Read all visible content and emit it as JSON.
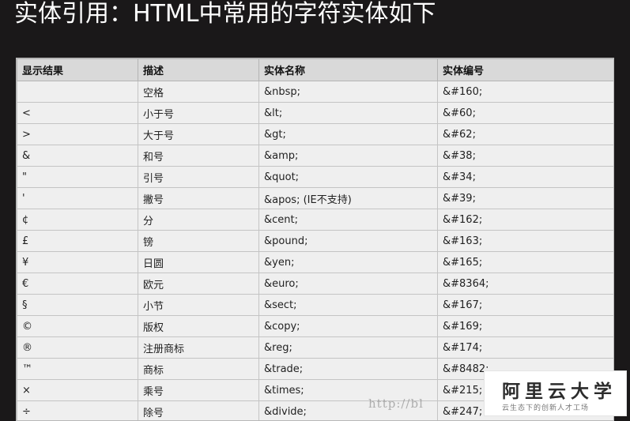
{
  "title": "实体引用：HTML中常用的字符实体如下",
  "table": {
    "headers": [
      "显示结果",
      "描述",
      "实体名称",
      "实体编号"
    ],
    "rows": [
      [
        "",
        "空格",
        "&nbsp;",
        "&#160;"
      ],
      [
        "<",
        "小于号",
        "&lt;",
        "&#60;"
      ],
      [
        ">",
        "大于号",
        "&gt;",
        "&#62;"
      ],
      [
        "&",
        "和号",
        "&amp;",
        "&#38;"
      ],
      [
        "\"",
        "引号",
        "&quot;",
        "&#34;"
      ],
      [
        "'",
        "撇号",
        "&apos; (IE不支持)",
        "&#39;"
      ],
      [
        "¢",
        "分",
        "&cent;",
        "&#162;"
      ],
      [
        "£",
        "镑",
        "&pound;",
        "&#163;"
      ],
      [
        "¥",
        "日圆",
        "&yen;",
        "&#165;"
      ],
      [
        "€",
        "欧元",
        "&euro;",
        "&#8364;"
      ],
      [
        "§",
        "小节",
        "&sect;",
        "&#167;"
      ],
      [
        "©",
        "版权",
        "&copy;",
        "&#169;"
      ],
      [
        "®",
        "注册商标",
        "&reg;",
        "&#174;"
      ],
      [
        "™",
        "商标",
        "&trade;",
        "&#8482;"
      ],
      [
        "×",
        "乘号",
        "&times;",
        "&#215;"
      ],
      [
        "÷",
        "除号",
        "&divide;",
        "&#247;"
      ]
    ]
  },
  "watermark": {
    "url": "http://bl"
  },
  "logo": {
    "name": "阿里云大学",
    "tagline": "云生态下的创新人才工场"
  },
  "colors": {
    "background": "#1a1819",
    "header_cell": "#d9d9d9",
    "body_cell": "#efefef",
    "title_text": "#ffffff"
  }
}
